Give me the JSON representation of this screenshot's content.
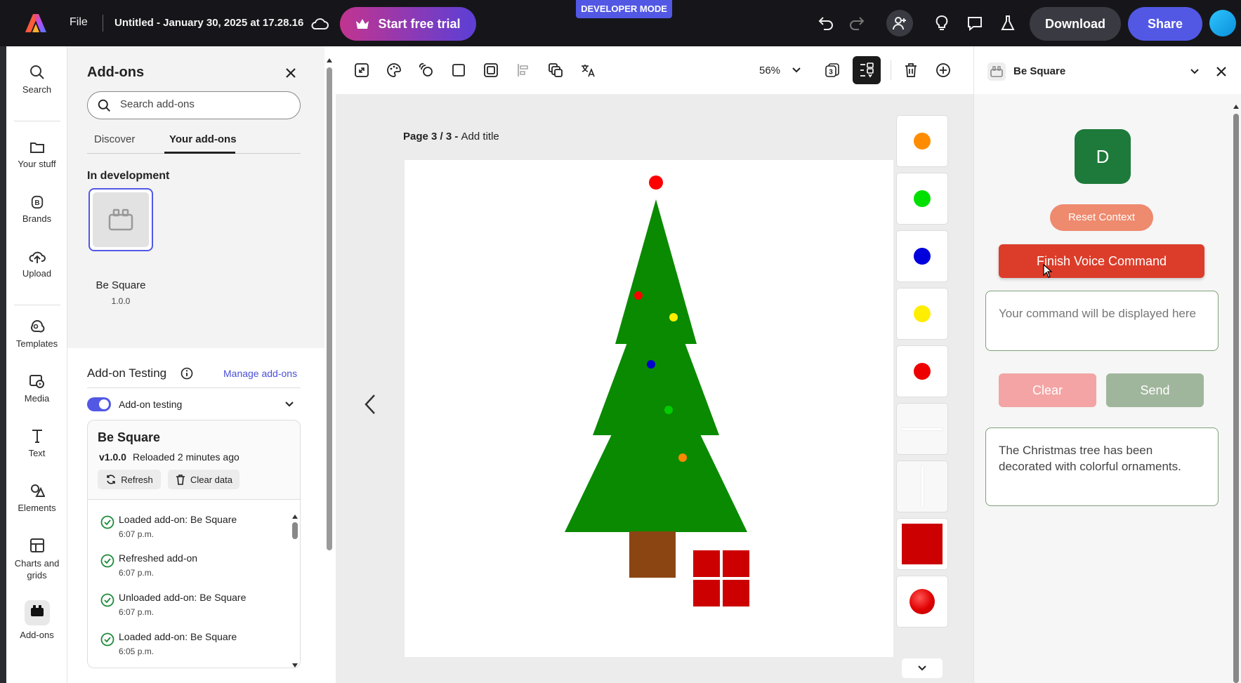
{
  "topbar": {
    "file_label": "File",
    "doc_title": "Untitled - January 30, 2025 at 17.28.16",
    "trial_label": "Start free trial",
    "dev_mode": "DEVELOPER MODE",
    "download_label": "Download",
    "share_label": "Share"
  },
  "rail": {
    "items": [
      {
        "label": "Search",
        "icon": "search-icon"
      },
      {
        "label": "Your stuff",
        "icon": "folder-icon"
      },
      {
        "label": "Brands",
        "icon": "brand-icon"
      },
      {
        "label": "Upload",
        "icon": "upload-icon"
      },
      {
        "label": "Templates",
        "icon": "templates-icon"
      },
      {
        "label": "Media",
        "icon": "media-icon"
      },
      {
        "label": "Text",
        "icon": "text-icon"
      },
      {
        "label": "Elements",
        "icon": "elements-icon"
      },
      {
        "label": "Charts and grids",
        "icon": "charts-icon"
      },
      {
        "label": "Add-ons",
        "icon": "addons-icon"
      }
    ]
  },
  "addons": {
    "title": "Add-ons",
    "search_placeholder": "Search add-ons",
    "tabs": [
      "Discover",
      "Your add-ons"
    ],
    "section_title": "In development",
    "addon_name": "Be Square",
    "addon_version": "1.0.0",
    "testing_title": "Add-on Testing",
    "manage_label": "Manage add-ons",
    "toggle_label": "Add-on testing",
    "card_name": "Be Square",
    "card_version": "v1.0.0",
    "card_status": "Reloaded 2 minutes ago",
    "refresh_label": "Refresh",
    "clear_data_label": "Clear data",
    "log": [
      {
        "text": "Loaded add-on: Be Square",
        "time": "6:07 p.m."
      },
      {
        "text": "Refreshed add-on",
        "time": "6:07 p.m."
      },
      {
        "text": "Unloaded add-on: Be Square",
        "time": "6:07 p.m."
      },
      {
        "text": "Loaded add-on: Be Square",
        "time": "6:05 p.m."
      }
    ]
  },
  "toolbar": {
    "zoom": "56%"
  },
  "canvas": {
    "page_label": "Page 3 / 3 - ",
    "add_title": "Add title",
    "swatches": [
      "#ff8c00",
      "#00e000",
      "#0000dd",
      "#ffee00",
      "#ee0000"
    ],
    "ornaments": [
      "#ff0000",
      "#ffee00",
      "#0000cc",
      "#00cc00",
      "#ff8800"
    ]
  },
  "right": {
    "title": "Be Square",
    "avatar_letter": "D",
    "reset_label": "Reset Context",
    "voice_label": "Finish Voice Command",
    "command_placeholder": "Your command will be displayed here",
    "clear_label": "Clear",
    "send_label": "Send",
    "response": "The Christmas tree has been decorated with colorful ornaments."
  },
  "colors": {
    "accent": "#5258e4",
    "voice_button": "#dc3d2a",
    "avatar": "#1d7a3a",
    "tree": "#0a8a00",
    "trunk": "#8b4513",
    "gift": "#cc0000"
  }
}
